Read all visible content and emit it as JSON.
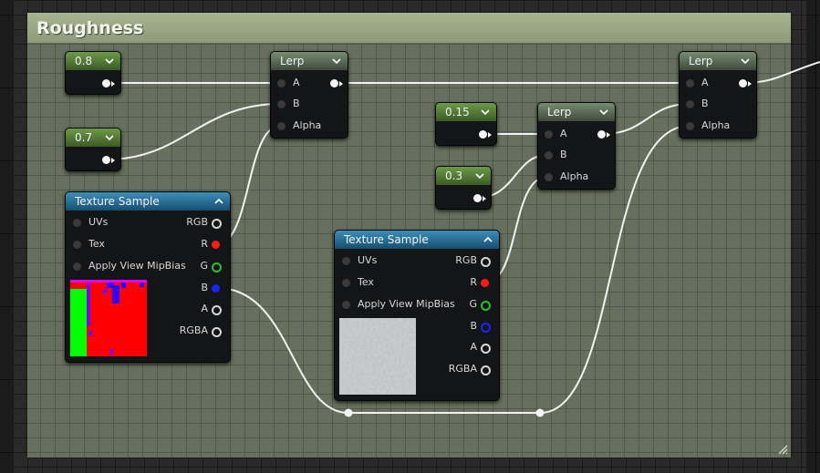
{
  "comment": {
    "title": "Roughness",
    "color": "#8e9b7b"
  },
  "constants": [
    {
      "id": "const-a",
      "value": "0.8"
    },
    {
      "id": "const-b",
      "value": "0.7"
    },
    {
      "id": "const-c",
      "value": "0.15"
    },
    {
      "id": "const-d",
      "value": "0.3"
    }
  ],
  "lerp_nodes": [
    {
      "id": "lerp-1",
      "title": "Lerp",
      "inputs": [
        "A",
        "B",
        "Alpha"
      ]
    },
    {
      "id": "lerp-2",
      "title": "Lerp",
      "inputs": [
        "A",
        "B",
        "Alpha"
      ]
    },
    {
      "id": "lerp-3",
      "title": "Lerp",
      "inputs": [
        "A",
        "B",
        "Alpha"
      ]
    }
  ],
  "texture_samples": [
    {
      "id": "tex-1",
      "title": "Texture Sample",
      "inputs": [
        "UVs",
        "Tex",
        "Apply View MipBias"
      ],
      "outputs": [
        "RGB",
        "R",
        "G",
        "B",
        "A",
        "RGBA"
      ],
      "thumbnail": "mask-texture"
    },
    {
      "id": "tex-2",
      "title": "Texture Sample",
      "inputs": [
        "UVs",
        "Tex",
        "Apply View MipBias"
      ],
      "outputs": [
        "RGB",
        "R",
        "G",
        "B",
        "A",
        "RGBA"
      ],
      "thumbnail": "concrete-texture"
    }
  ],
  "colors": {
    "pin_red": "#ff1a1a",
    "pin_green": "#29c12a",
    "pin_blue": "#1a22ff",
    "header_constant": "#6d9a4a",
    "header_lerp": "#7a8c73",
    "header_texture": "#3c8fbb"
  },
  "icons": [
    "chevron-down-icon",
    "chevron-up-icon",
    "resize-grip-icon"
  ]
}
